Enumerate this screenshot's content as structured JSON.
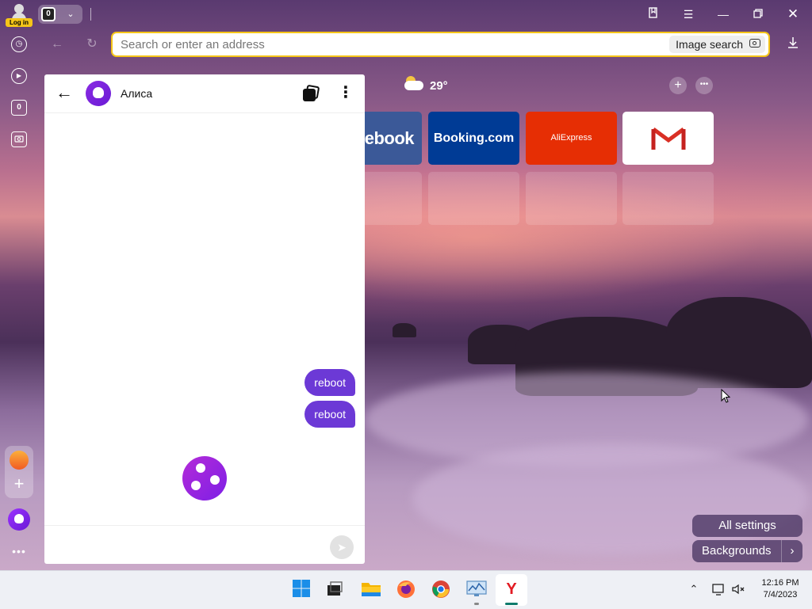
{
  "browser": {
    "login_label": "Log in",
    "tab_count": "0",
    "address_placeholder": "Search or enter an address",
    "image_search_label": "Image search"
  },
  "sidebar": {
    "tab_count": "0"
  },
  "alice_panel": {
    "name": "Алиса",
    "messages": [
      {
        "text": "reboot"
      },
      {
        "text": "reboot"
      }
    ]
  },
  "newtab": {
    "weather_temp": "29°",
    "tiles": [
      {
        "label": "ebook"
      },
      {
        "label": "Booking.com"
      },
      {
        "label": "AliExpress"
      },
      {
        "label": "Gmail"
      }
    ],
    "all_settings_label": "All settings",
    "backgrounds_label": "Backgrounds"
  },
  "taskbar": {
    "time": "12:16 PM",
    "date": "7/4/2023"
  },
  "colors": {
    "accent_yellow": "#f5c518",
    "alice_purple": "#6c39d6",
    "booking_blue": "#003b95",
    "aliexpress_red": "#e62e04",
    "facebook_blue": "#3b5998"
  }
}
